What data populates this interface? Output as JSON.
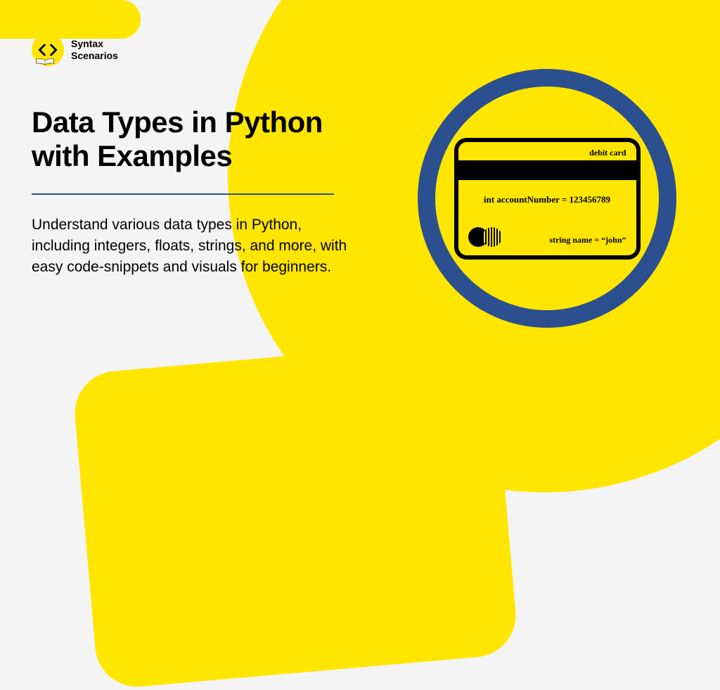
{
  "logo": {
    "line1": "Syntax",
    "line2": "Scenarios"
  },
  "content": {
    "title": "Data Types in Python with Examples",
    "description": "Understand various data types in Python, including integers, floats, strings, and more, with easy code-snippets and visuals for beginners."
  },
  "card": {
    "label": "debit card",
    "code_line1": "int accountNumber = 123456789",
    "code_line2": "string name = “john”"
  },
  "colors": {
    "yellow": "#ffe600",
    "blue": "#2c4f8f",
    "black": "#000000"
  }
}
